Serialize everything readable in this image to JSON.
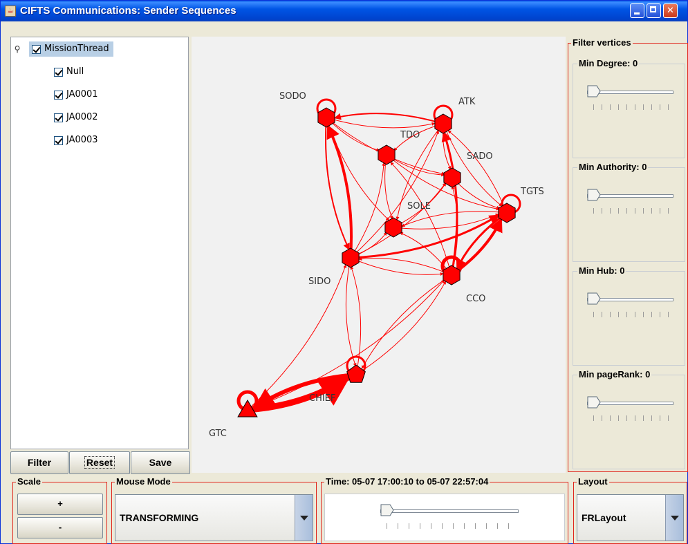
{
  "window": {
    "title": "CIFTS Communications: Sender Sequences"
  },
  "tree": {
    "root_label": "MissionThread",
    "children": [
      "Null",
      "JA0001",
      "JA0002",
      "JA0003"
    ]
  },
  "buttons": {
    "filter": "Filter",
    "reset": "Reset",
    "save": "Save"
  },
  "graph": {
    "nodes": [
      {
        "id": "SODO",
        "label": "SODO",
        "shape": "hexagon"
      },
      {
        "id": "ATK",
        "label": "ATK",
        "shape": "hexagon"
      },
      {
        "id": "TDO",
        "label": "TDO",
        "shape": "hexagon"
      },
      {
        "id": "SADO",
        "label": "SADO",
        "shape": "hexagon"
      },
      {
        "id": "TGTS",
        "label": "TGTS",
        "shape": "hexagon"
      },
      {
        "id": "SOLE",
        "label": "SOLE",
        "shape": "hexagon"
      },
      {
        "id": "SIDO",
        "label": "SIDO",
        "shape": "hexagon"
      },
      {
        "id": "CCO",
        "label": "CCO",
        "shape": "hexagon"
      },
      {
        "id": "CHIEF",
        "label": "CHIEF",
        "shape": "pentagon"
      },
      {
        "id": "GTC",
        "label": "GTC",
        "shape": "triangle"
      }
    ],
    "edges": [
      [
        "GTC",
        "CHIEF"
      ],
      [
        "CHIEF",
        "GTC"
      ],
      [
        "GTC",
        "SIDO"
      ],
      [
        "GTC",
        "CCO"
      ],
      [
        "CHIEF",
        "SIDO"
      ],
      [
        "CHIEF",
        "CCO"
      ],
      [
        "SIDO",
        "CHIEF"
      ],
      [
        "CCO",
        "CHIEF"
      ],
      [
        "SIDO",
        "SODO"
      ],
      [
        "SODO",
        "SIDO"
      ],
      [
        "SIDO",
        "TDO"
      ],
      [
        "SIDO",
        "SOLE"
      ],
      [
        "SIDO",
        "SADO"
      ],
      [
        "SIDO",
        "TGTS"
      ],
      [
        "SIDO",
        "ATK"
      ],
      [
        "SIDO",
        "CCO"
      ],
      [
        "CCO",
        "SIDO"
      ],
      [
        "CCO",
        "TGTS"
      ],
      [
        "TGTS",
        "CCO"
      ],
      [
        "CCO",
        "ATK"
      ],
      [
        "CCO",
        "SADO"
      ],
      [
        "CCO",
        "SOLE"
      ],
      [
        "CCO",
        "TDO"
      ],
      [
        "SODO",
        "ATK"
      ],
      [
        "ATK",
        "SODO"
      ],
      [
        "SODO",
        "TDO"
      ],
      [
        "SODO",
        "SOLE"
      ],
      [
        "SODO",
        "SADO"
      ],
      [
        "ATK",
        "TDO"
      ],
      [
        "ATK",
        "SADO"
      ],
      [
        "ATK",
        "SOLE"
      ],
      [
        "ATK",
        "TGTS"
      ],
      [
        "TDO",
        "SADO"
      ],
      [
        "TDO",
        "SOLE"
      ],
      [
        "SOLE",
        "SADO"
      ],
      [
        "SOLE",
        "TGTS"
      ],
      [
        "TGTS",
        "SOLE"
      ],
      [
        "TGTS",
        "ATK"
      ],
      [
        "SADO",
        "TGTS"
      ],
      [
        "TDO",
        "TGTS"
      ]
    ],
    "self_loops": [
      "SODO",
      "ATK",
      "TGTS",
      "CCO",
      "CHIEF",
      "GTC"
    ],
    "node_color": "#ff0000",
    "edge_color": "#ff0000"
  },
  "filter_vertices": {
    "title": "Filter vertices",
    "min_degree": "Min Degree: 0",
    "min_authority": "Min Authority: 0",
    "min_hub": "Min Hub: 0",
    "min_pagerank": "Min pageRank: 0"
  },
  "scale": {
    "title": "Scale",
    "plus": "+",
    "minus": "-"
  },
  "mouse_mode": {
    "title": "Mouse Mode",
    "value": "TRANSFORMING"
  },
  "time": {
    "title": "Time: 05-07 17:00:10 to 05-07 22:57:04"
  },
  "layout": {
    "title": "Layout",
    "value": "FRLayout"
  },
  "accent": "#e0241b"
}
